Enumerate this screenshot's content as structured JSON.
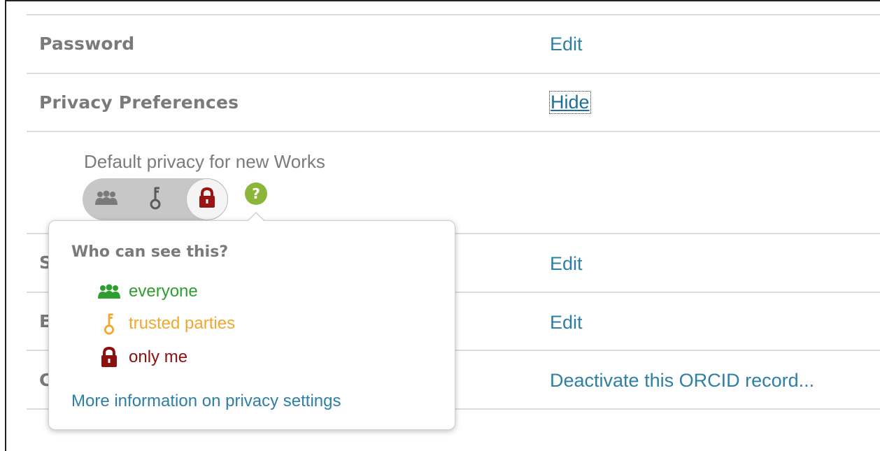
{
  "rows": {
    "password": {
      "label": "Password",
      "action": "Edit"
    },
    "privacy": {
      "label": "Privacy Preferences",
      "action": "Hide"
    },
    "row3": {
      "label": "S",
      "action": "Edit"
    },
    "row4": {
      "label": "E",
      "action": "Edit"
    },
    "row5": {
      "label": "C",
      "action": "Deactivate this ORCID record..."
    }
  },
  "privacy_default": {
    "label": "Default privacy for new Works",
    "options": [
      "everyone-icon",
      "key-icon",
      "lock-icon"
    ],
    "selected": "only me",
    "help_glyph": "?"
  },
  "popover": {
    "title": "Who can see this?",
    "items": [
      {
        "label": "everyone",
        "icon": "everyone-icon",
        "color": "#2e9e2e"
      },
      {
        "label": "trusted parties",
        "icon": "key-icon",
        "color": "#f0a830"
      },
      {
        "label": "only me",
        "icon": "lock-icon",
        "color": "#8b1010"
      }
    ],
    "more_link": "More information on privacy settings"
  },
  "colors": {
    "link": "#2e7fa6",
    "label_gray": "#7a7a7a",
    "help_green": "#8bb63a",
    "lock_red": "#9b1414"
  }
}
